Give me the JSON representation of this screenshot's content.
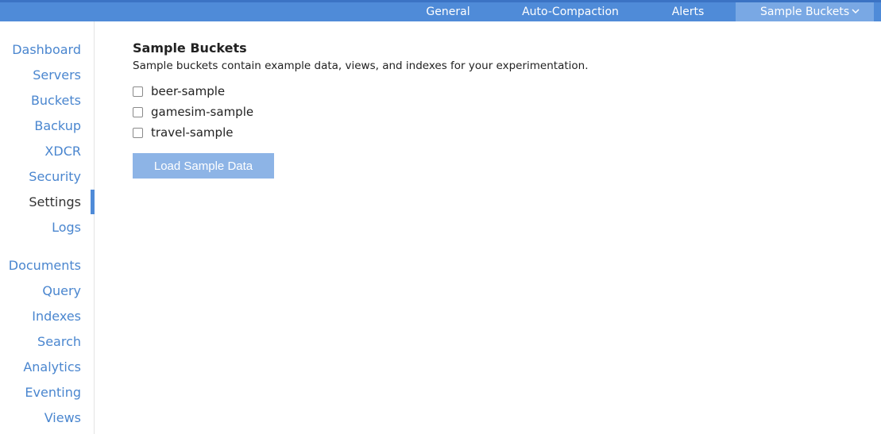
{
  "top_tabs": {
    "general": "General",
    "auto_compaction": "Auto-Compaction",
    "alerts": "Alerts",
    "sample_buckets": "Sample Buckets",
    "sample_buckets_icon": "chevron-down-icon"
  },
  "sidebar": {
    "items": [
      {
        "label": "Dashboard"
      },
      {
        "label": "Servers"
      },
      {
        "label": "Buckets"
      },
      {
        "label": "Backup"
      },
      {
        "label": "XDCR"
      },
      {
        "label": "Security"
      },
      {
        "label": "Settings",
        "active": true
      },
      {
        "label": "Logs"
      },
      {
        "label": "Documents"
      },
      {
        "label": "Query"
      },
      {
        "label": "Indexes"
      },
      {
        "label": "Search"
      },
      {
        "label": "Analytics"
      },
      {
        "label": "Eventing"
      },
      {
        "label": "Views"
      }
    ]
  },
  "main": {
    "title": "Sample Buckets",
    "subtitle": "Sample buckets contain example data, views, and indexes for your experimentation.",
    "samples": [
      {
        "label": "beer-sample",
        "checked": false
      },
      {
        "label": "gamesim-sample",
        "checked": false
      },
      {
        "label": "travel-sample",
        "checked": false
      }
    ],
    "load_button": "Load Sample Data"
  },
  "colors": {
    "topbar": "#4f8bd8",
    "active_tab": "#79a8e4",
    "nav_link": "#4a86cf",
    "button_disabled": "#8db4e6"
  }
}
